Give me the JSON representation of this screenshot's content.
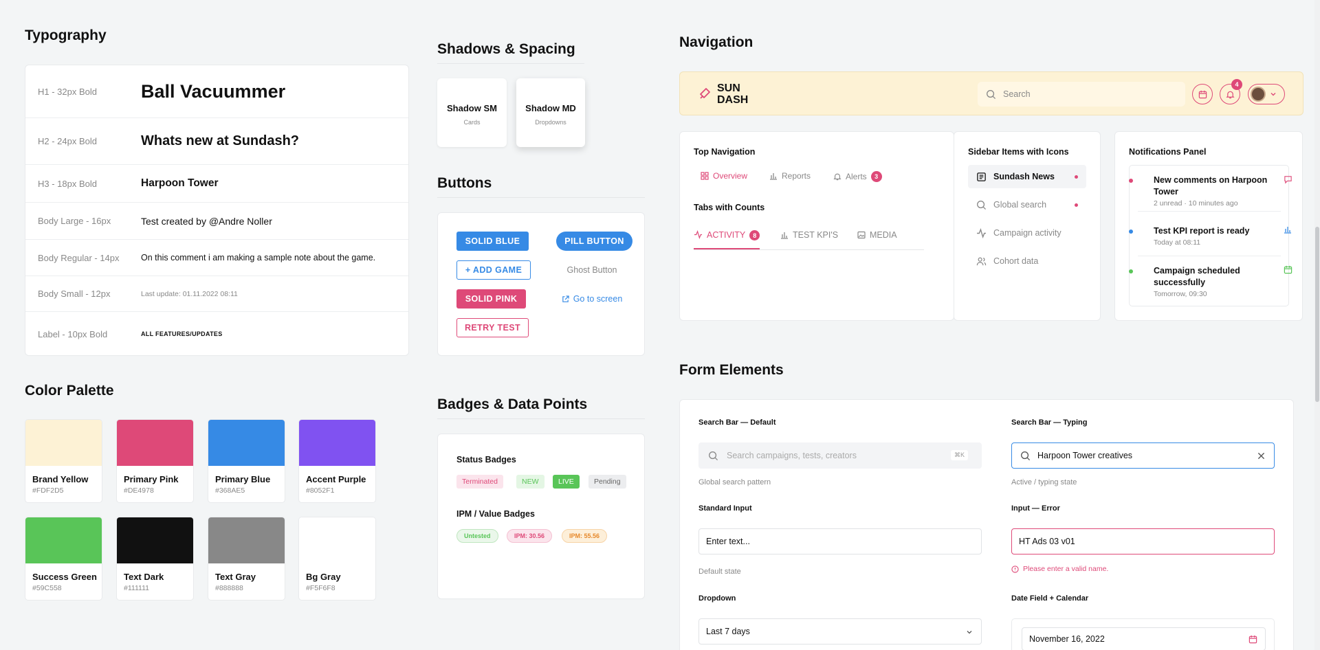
{
  "typography": {
    "title": "Typography",
    "rows": [
      {
        "label": "H1 - 32px Bold",
        "sample": "Ball Vacuummer"
      },
      {
        "label": "H2 - 24px Bold",
        "sample": "Whats new at Sundash?"
      },
      {
        "label": "H3 - 18px Bold",
        "sample": "Harpoon Tower"
      },
      {
        "label": "Body Large - 16px",
        "sample": "Test created by @Andre Noller"
      },
      {
        "label": "Body Regular - 14px",
        "sample": "On this comment i am making a sample note about the game."
      },
      {
        "label": "Body Small - 12px",
        "sample": "Last update: 01.11.2022 08:11"
      },
      {
        "label": "Label - 10px Bold",
        "sample": "ALL FEATURES/UPDATES"
      }
    ]
  },
  "shadows": {
    "title": "Shadows & Spacing",
    "sm": {
      "title": "Shadow SM",
      "sub": "Cards"
    },
    "md": {
      "title": "Shadow MD",
      "sub": "Dropdowns"
    }
  },
  "buttons": {
    "title": "Buttons",
    "solid_blue": "SOLID BLUE",
    "pill": "PILL BUTTON",
    "add_game": "+ ADD GAME",
    "ghost": "Ghost Button",
    "solid_pink": "SOLID PINK",
    "goto": "Go to screen",
    "retry": "RETRY TEST"
  },
  "palette": {
    "title": "Color Palette",
    "colors": [
      {
        "name": "Brand Yellow",
        "hex": "#FDF2D5"
      },
      {
        "name": "Primary Pink",
        "hex": "#DE4978"
      },
      {
        "name": "Primary Blue",
        "hex": "#368AE5"
      },
      {
        "name": "Accent Purple",
        "hex": "#8052F1"
      },
      {
        "name": "Success Green",
        "hex": "#59C558"
      },
      {
        "name": "Text Dark",
        "hex": "#111111"
      },
      {
        "name": "Text Gray",
        "hex": "#888888"
      },
      {
        "name": "Bg Gray",
        "hex": "#F5F6F8"
      }
    ]
  },
  "badges": {
    "title": "Badges & Data Points",
    "status_title": "Status Badges",
    "status": [
      "Terminated",
      "NEW",
      "LIVE",
      "Pending"
    ],
    "ipm_title": "IPM / Value Badges",
    "ipm": [
      "Untested",
      "IPM: 30.56",
      "IPM: 55.56"
    ]
  },
  "navigation": {
    "title": "Navigation",
    "brand": {
      "line1": "SUN",
      "line2": "DASH"
    },
    "search_placeholder": "Search",
    "notif_count": "4",
    "top_nav": {
      "title": "Top Navigation",
      "items": [
        "Overview",
        "Reports",
        "Alerts"
      ],
      "alerts_count": "3"
    },
    "tabs": {
      "title": "Tabs with Counts",
      "items": [
        "ACTIVITY",
        "TEST KPI'S",
        "MEDIA"
      ],
      "activity_count": "8"
    },
    "sidebar": {
      "title": "Sidebar Items with Icons",
      "items": [
        "Sundash News",
        "Global search",
        "Campaign activity",
        "Cohort data"
      ]
    },
    "notifications": {
      "title": "Notifications Panel",
      "items": [
        {
          "title": "New comments on Harpoon Tower",
          "sub": "2 unread · 10 minutes ago"
        },
        {
          "title": "Test KPI report is ready",
          "sub": "Today at 08:11"
        },
        {
          "title": "Campaign scheduled successfully",
          "sub": "Tomorrow, 09:30"
        }
      ]
    }
  },
  "forms": {
    "title": "Form Elements",
    "search_default": {
      "label": "Search Bar — Default",
      "placeholder": "Search campaigns, tests, creators",
      "shortcut": "⌘K",
      "hint": "Global search pattern"
    },
    "search_typing": {
      "label": "Search Bar — Typing",
      "value": "Harpoon Tower creatives",
      "hint": "Active / typing state"
    },
    "standard": {
      "label": "Standard Input",
      "placeholder": "Enter text...",
      "hint": "Default state"
    },
    "error": {
      "label": "Input — Error",
      "value": "HT Ads 03 v01",
      "message": "Please enter a valid name."
    },
    "dropdown": {
      "label": "Dropdown",
      "value": "Last 7 days"
    },
    "date": {
      "label": "Date Field + Calendar",
      "value": "November 16, 2022"
    }
  }
}
